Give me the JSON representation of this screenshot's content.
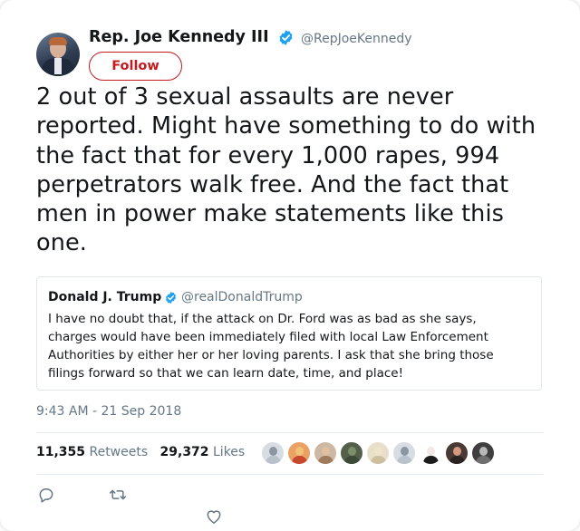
{
  "author": {
    "display_name": "Rep. Joe Kennedy III",
    "handle": "@RepJoeKennedy",
    "verified": true,
    "follow_label": "Follow",
    "follow_color": "#c31a1f"
  },
  "tweet": {
    "text": "2 out of 3 sexual assaults are never reported. Might have something to do with the fact that for every 1,000 rapes, 994 perpetrators walk free. And the fact that men in power make statements like this one.",
    "timestamp": "9:43 AM - 21 Sep 2018"
  },
  "quoted_tweet": {
    "display_name": "Donald J. Trump",
    "handle": "@realDonaldTrump",
    "verified": true,
    "text": "I have no doubt that, if the attack on Dr. Ford was as bad as she says, charges would have been immediately filed with local Law Enforcement Authorities by either her or her loving parents. I ask that she bring those filings forward so that we can learn  date, time, and place!"
  },
  "stats": {
    "retweets_count": "11,355",
    "retweets_label": "Retweets",
    "likes_count": "29,372",
    "likes_label": "Likes"
  },
  "likers": [
    {
      "face": "#8c96a3",
      "body": "#b9c1cb",
      "bg": "#d7dde3"
    },
    {
      "face": "#f0c27a",
      "body": "#c6482f",
      "bg": "#e9a264"
    },
    {
      "face": "#e0c09f",
      "body": "#a07a5c",
      "bg": "#cdb9a3"
    },
    {
      "face": "#7c8f6a",
      "body": "#3d4a37",
      "bg": "#55604b"
    },
    {
      "face": "#efe3c8",
      "body": "#cbbf9f",
      "bg": "#e7dfca"
    },
    {
      "face": "#8c96a3",
      "body": "#b9c1cb",
      "bg": "#d7dde3"
    },
    {
      "face": "#f3e8e6",
      "body": "#1c1c1c",
      "bg": "#ffffff"
    },
    {
      "face": "#d59a7e",
      "body": "#2b2222",
      "bg": "#4a3a36"
    },
    {
      "face": "#b9b9b9",
      "body": "#6f6f6f",
      "bg": "#3f3f3f"
    }
  ],
  "icons": {
    "verified": "verified-badge-icon",
    "reply": "reply-icon",
    "retweet": "retweet-icon",
    "like": "heart-icon"
  },
  "colors": {
    "brand_blue": "#1da1f2",
    "muted": "#657786",
    "text": "#14171a"
  }
}
